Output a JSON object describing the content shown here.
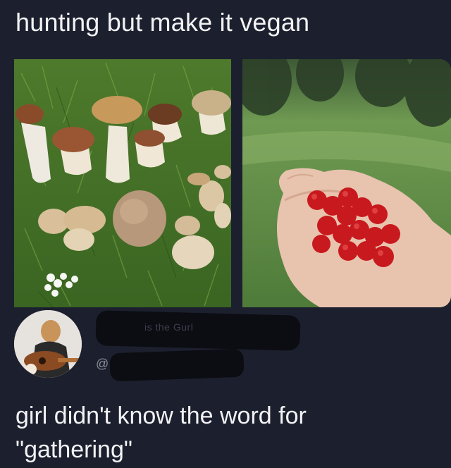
{
  "meme": {
    "top_caption": "hunting but make it vegan",
    "bottom_caption_line1": "girl didn't know the word for",
    "bottom_caption_line2": "\"gathering\""
  },
  "tweet": {
    "display_name_visible": "is the Gurl",
    "handle_prefix": "@"
  },
  "images": {
    "left": "mushrooms-on-grass",
    "right": "hand-holding-red-berries"
  },
  "colors": {
    "background": "#1c202e",
    "text": "#f2f2f4",
    "redaction": "#0c0d12"
  }
}
